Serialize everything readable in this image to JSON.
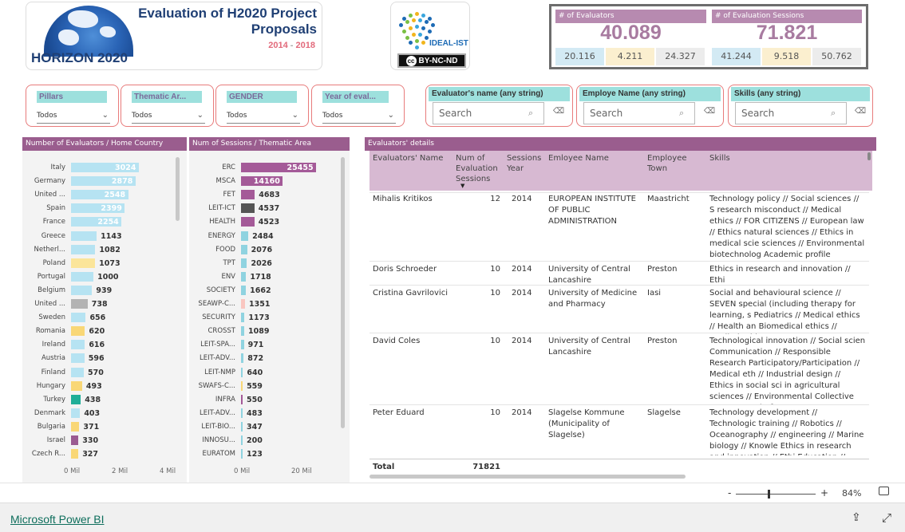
{
  "header": {
    "title": "Evaluation of H2020 Project Proposals",
    "year_start": "2014",
    "year_sep": " - ",
    "year_end": "2018",
    "program": "HORIZON 2020",
    "logo_text": "IDEAL-IST",
    "license": "BY-NC-ND"
  },
  "kpis": {
    "evaluators": {
      "label": "# of Evaluators",
      "value": "40.089",
      "breakdown": [
        "20.116",
        "4.211",
        "24.327"
      ]
    },
    "sessions": {
      "label": "# of Evaluation Sessions",
      "value": "71.821",
      "breakdown": [
        "41.244",
        "9.518",
        "50.762"
      ]
    },
    "colors": {
      "header": "#b78ab0",
      "value": "#a87ba0",
      "cell_blue": "#d3eaf4",
      "cell_yellow": "#fbefcf",
      "cell_grey": "#ececec"
    }
  },
  "slicers": [
    {
      "label": "Pillars",
      "value": "Todos"
    },
    {
      "label": "Thematic Ar...",
      "value": "Todos"
    },
    {
      "label": "GENDER",
      "value": "Todos"
    },
    {
      "label": "Year of eval...",
      "value": "Todos"
    }
  ],
  "searches": [
    {
      "label": "Evaluator's name (any string)",
      "placeholder": "Search"
    },
    {
      "label": "Employe Name (any string)",
      "placeholder": "Search"
    },
    {
      "label": "Skills (any string)",
      "placeholder": "Search"
    }
  ],
  "chart_data": [
    {
      "type": "bar",
      "title": "Number of Evaluators / Home Country",
      "categories": [
        "Italy",
        "Germany",
        "United ...",
        "Spain",
        "France",
        "Greece",
        "Netherl...",
        "Poland",
        "Portugal",
        "Belgium",
        "United ...",
        "Sweden",
        "Romania",
        "Ireland",
        "Austria",
        "Finland",
        "Hungary",
        "Turkey",
        "Denmark",
        "Bulgaria",
        "Israel",
        "Czech R..."
      ],
      "values": [
        3024,
        2878,
        2548,
        2399,
        2254,
        1143,
        1082,
        1073,
        1000,
        939,
        738,
        656,
        620,
        616,
        596,
        570,
        493,
        438,
        403,
        371,
        330,
        327
      ],
      "colors": [
        "#b6e3f2",
        "#b6e3f2",
        "#b6e3f2",
        "#b6e3f2",
        "#b6e3f2",
        "#b6e3f2",
        "#b6e3f2",
        "#fbe59a",
        "#b6e3f2",
        "#b6e3f2",
        "#b3b3b3",
        "#b6e3f2",
        "#f9d776",
        "#b6e3f2",
        "#b6e3f2",
        "#b6e3f2",
        "#f9d776",
        "#1fae98",
        "#b6e3f2",
        "#f9d776",
        "#9b5b91",
        "#f9d776"
      ],
      "xlim": [
        0,
        4000000
      ],
      "xticks": [
        "0 Mil",
        "2 Mil",
        "4 Mil"
      ]
    },
    {
      "type": "bar",
      "title": "Num of Sessions / Thematic Area",
      "categories": [
        "ERC",
        "MSCA",
        "FET",
        "LEIT-ICT",
        "HEALTH",
        "ENERGY",
        "FOOD",
        "TPT",
        "ENV",
        "SOCIETY",
        "SEAWP-C...",
        "SECURITY",
        "CROSST",
        "LEIT-SPA...",
        "LEIT-ADV...",
        "LEIT-NMP",
        "SWAFS-C...",
        "INFRA",
        "LEIT-ADV...",
        "LEIT-BIO...",
        "INNOSU...",
        "EURATOM"
      ],
      "values": [
        25455,
        14160,
        4683,
        4537,
        4523,
        2484,
        2076,
        2026,
        1718,
        1662,
        1351,
        1173,
        1089,
        971,
        872,
        640,
        559,
        550,
        483,
        347,
        200,
        123
      ],
      "colors": [
        "#a45a98",
        "#a45a98",
        "#a45a98",
        "#555555",
        "#a45a98",
        "#8fd3e0",
        "#8fd3e0",
        "#8fd3e0",
        "#8fd3e0",
        "#8fd3e0",
        "#f9c6c0",
        "#8fd3e0",
        "#8fd3e0",
        "#8fd3e0",
        "#8fd3e0",
        "#8fd3e0",
        "#f9d776",
        "#a45a98",
        "#8fd3e0",
        "#8fd3e0",
        "#8fd3e0",
        "#8fd3e0"
      ],
      "xlim": [
        0,
        25455
      ],
      "xticks": [
        "0 Mil",
        "20 Mil"
      ]
    }
  ],
  "table": {
    "title": "Evaluators' details",
    "columns": [
      "Evaluators' Name",
      "Num of Evaluation Sessions",
      "Sessions Year",
      "Emloyee Name",
      "Employee Town",
      "Skills"
    ],
    "rows": [
      {
        "name": "Mihalis Kritikos",
        "num": "12",
        "year": "2014",
        "employee": "EUROPEAN INSTITUTE OF PUBLIC ADMINISTRATION",
        "town": "Maastricht",
        "skills": "Technology policy // Social sciences // S research misconduct // Medical ethics // FOR CITIZENS // European law // Ethics natural sciences // Ethics in medical scie sciences // Environmental biotechnolog Academic profile"
      },
      {
        "name": "Doris Schroeder",
        "num": "10",
        "year": "2014",
        "employee": "University of Central Lancashire",
        "town": "Preston",
        "skills": "Ethics in research and innovation // Ethi"
      },
      {
        "name": "Cristina Gavrilovici",
        "num": "10",
        "year": "2014",
        "employee": "University of Medicine and Pharmacy",
        "town": "Iasi",
        "skills": "Social and behavioural science // SEVEN special (including therapy for learning, s Pediatrics // Medical ethics // Health an Biomedical ethics // Applied ethics"
      },
      {
        "name": "David Coles",
        "num": "10",
        "year": "2014",
        "employee": "University of Central Lancashire",
        "town": "Preston",
        "skills": "Technological innovation // Social scien Communication // Responsible Research Participatory/Participation // Medical eth // Industrial design // Ethics in social sci in agricultural sciences // Environmental Collective Awareness Platforms"
      },
      {
        "name": "Peter Eduard",
        "num": "10",
        "year": "2014",
        "employee": "Slagelse Kommune (Municipality of Slagelse)",
        "town": "Slagelse",
        "skills": "Technology development // Technologic training // Robotics // Oceanography // engineering // Marine biology // Knowle Ethics in research and innovation // Ethi Education // Ecology // Conducting cor"
      }
    ],
    "total_label": "Total",
    "total_value": "71821"
  },
  "zoom": {
    "minus": "-",
    "plus": "+",
    "level": "84%"
  },
  "footer": {
    "link": "Microsoft Power BI"
  }
}
